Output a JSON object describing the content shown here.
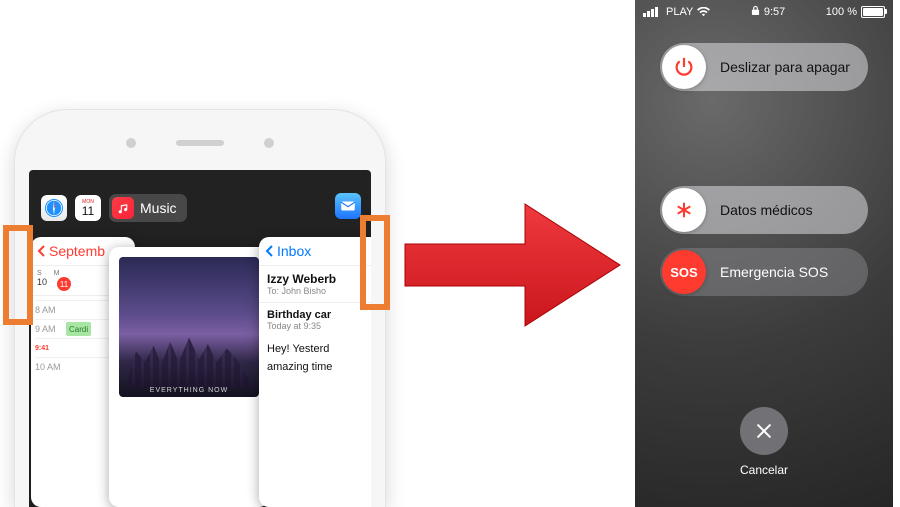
{
  "left_phone": {
    "music_label": "Music",
    "calendar_card": {
      "back_label": "Septemb",
      "weekday_labels": [
        "S",
        "M"
      ],
      "dates": [
        "10",
        "11"
      ],
      "hour_labels": [
        "8 AM",
        "9 AM",
        "10 AM"
      ],
      "now_marker": "9:41",
      "event_title": "Cardi"
    },
    "music_card": {
      "album_caption": "EVERYTHING NOW"
    },
    "mail_card": {
      "back_label": "Inbox",
      "from": "Izzy Weberb",
      "to_prefix": "To:",
      "to_name": "John Bisho",
      "subject": "Birthday car",
      "subject_sub": "Today at 9:35",
      "body_line1": "Hey! Yesterd",
      "body_line2": "amazing time"
    }
  },
  "right_phone": {
    "statusbar": {
      "carrier": "PLAY",
      "wifi": true,
      "lock": true,
      "time": "9:57",
      "battery_pct": "100 %"
    },
    "power_off_label": "Deslizar para apagar",
    "medical_id_label": "Datos médicos",
    "sos_label": "Emergencia SOS",
    "sos_knob_text": "SOS",
    "cancel_label": "Cancelar"
  },
  "colors": {
    "callout": "#ed7d31",
    "arrow": "#e31b23",
    "ios_red": "#ff3b30",
    "ios_blue": "#007aff"
  }
}
